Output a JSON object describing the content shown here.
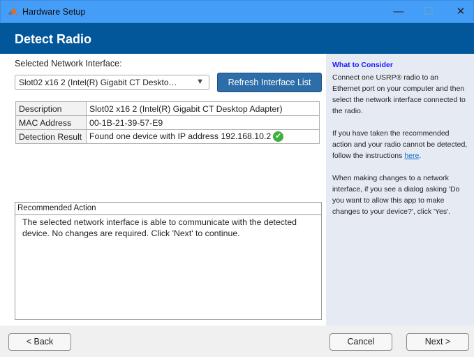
{
  "window": {
    "title": "Hardware Setup",
    "minimize": "—",
    "maximize": "☐",
    "close": "✕"
  },
  "header": {
    "title": "Detect Radio"
  },
  "main": {
    "interface_label": "Selected Network Interface:",
    "interface_value": "Slot02 x16 2 (Intel(R) Gigabit CT Deskto…",
    "refresh_label": "Refresh Interface List",
    "table": [
      {
        "key": "Description",
        "value": "Slot02 x16 2 (Intel(R) Gigabit CT Desktop Adapter)"
      },
      {
        "key": "MAC Address",
        "value": "00-1B-21-39-57-E9"
      },
      {
        "key": "Detection Result",
        "value": "Found one device with IP address 192.168.10.2"
      }
    ],
    "recommended_title": "Recommended Action",
    "recommended_text": "The selected network interface is able to communicate with the detected device. No changes are required. Click 'Next' to continue."
  },
  "side": {
    "title": "What to Consider",
    "p1": "Connect one USRP® radio to an Ethernet port on your computer and then select the network interface connected to the radio.",
    "p2_pre": "If you have taken the recommended action and your radio cannot be detected, follow the instructions ",
    "p2_link": "here",
    "p2_post": ".",
    "p3": "When making changes to a network interface, if you see a dialog asking 'Do you want to allow this app to make changes to your device?', click 'Yes'."
  },
  "footer": {
    "back": "< Back",
    "cancel": "Cancel",
    "next": "Next >"
  }
}
